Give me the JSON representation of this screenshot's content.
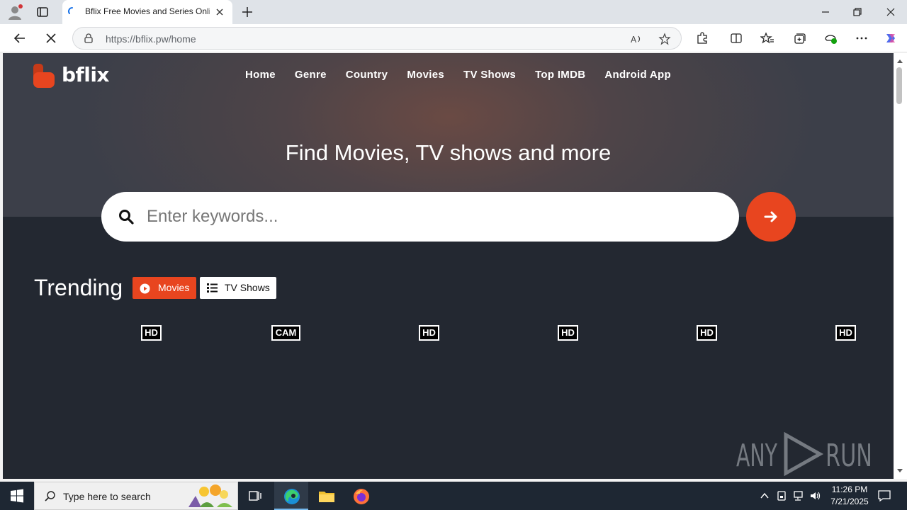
{
  "browser": {
    "tab_title": "Bflix Free Movies and Series Online",
    "url_host": "https://bflix.pw",
    "url_path": "/home"
  },
  "site": {
    "logo_text": "bflix",
    "nav": [
      "Home",
      "Genre",
      "Country",
      "Movies",
      "TV Shows",
      "Top IMDB",
      "Android App"
    ],
    "hero_title": "Find Movies, TV shows and more",
    "search_placeholder": "Enter keywords...",
    "accent_color": "#e8451f",
    "trending": {
      "title": "Trending",
      "filter_movies": "Movies",
      "filter_tv": "TV Shows",
      "badges": [
        "HD",
        "CAM",
        "HD",
        "HD",
        "HD",
        "HD"
      ]
    },
    "watermark": "ANY RUN"
  },
  "taskbar": {
    "search_placeholder": "Type here to search",
    "time": "11:26 PM",
    "date": "7/21/2025"
  }
}
